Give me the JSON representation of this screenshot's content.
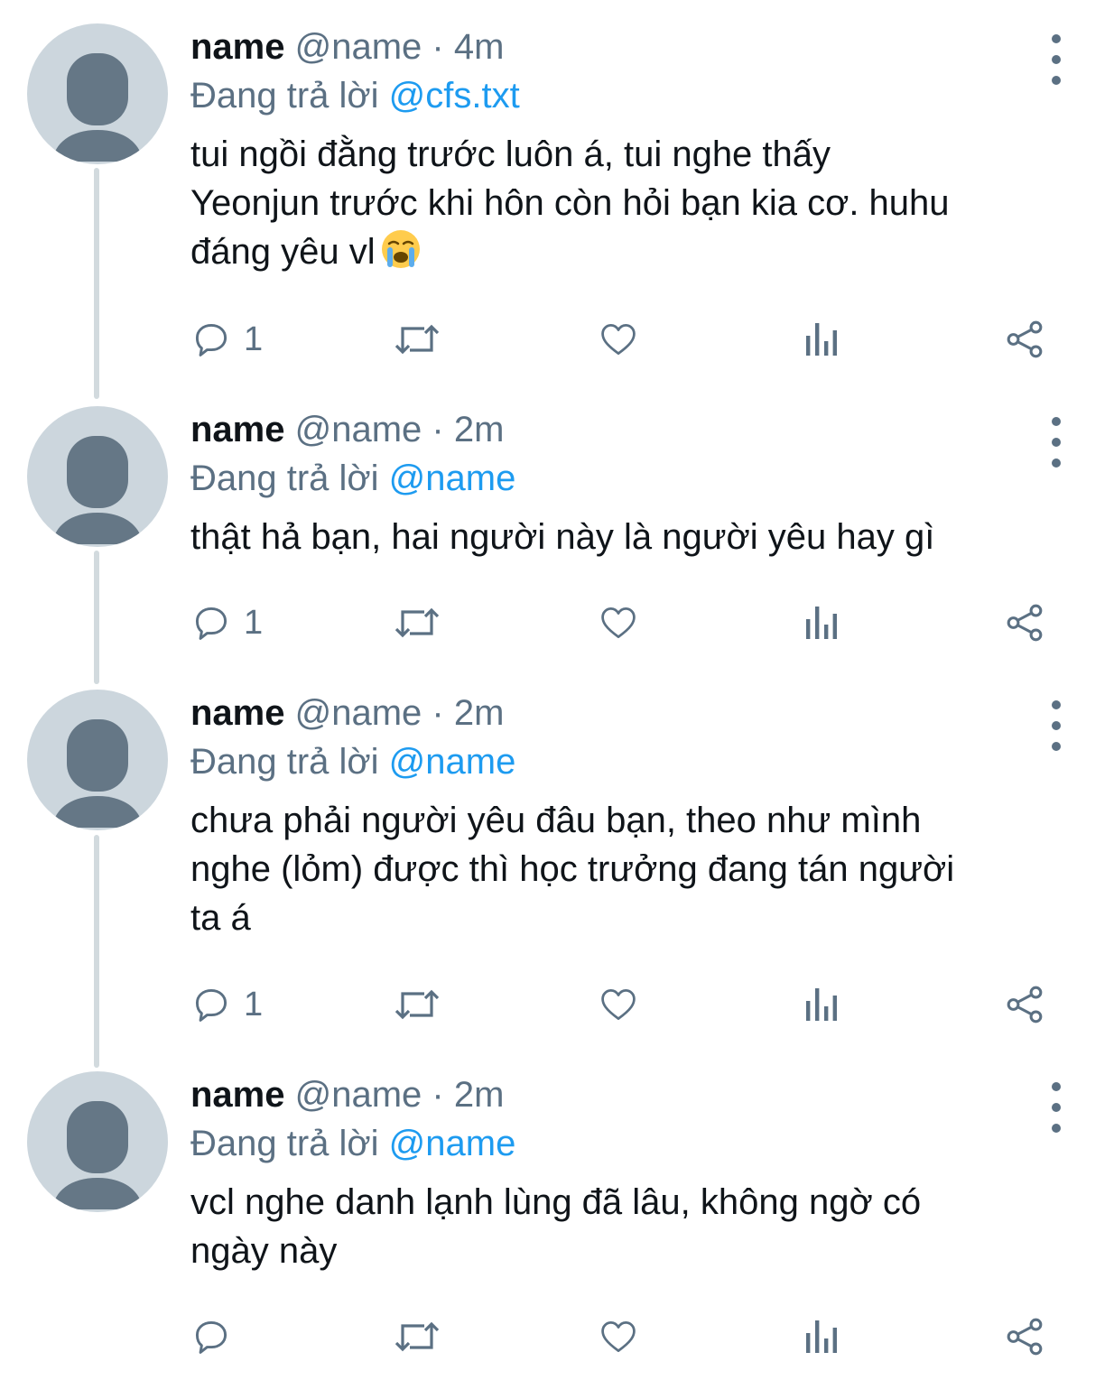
{
  "tweets": [
    {
      "name": "name",
      "handle": "@name",
      "separator": "·",
      "time": "4m",
      "reply_prefix": "Đang trả lời",
      "reply_to": "@cfs.txt",
      "text": "tui ngồi đằng trước luôn á, tui nghe thấy\nYeonjun trước khi hôn còn hỏi bạn kia cơ. huhu\nđáng yêu vl",
      "emoji": "loudly-crying-face",
      "reply_count": "1"
    },
    {
      "name": "name",
      "handle": "@name",
      "separator": "·",
      "time": "2m",
      "reply_prefix": "Đang trả lời",
      "reply_to": "@name",
      "text": "thật hả bạn, hai người này là người yêu hay gì",
      "reply_count": "1"
    },
    {
      "name": "name",
      "handle": "@name",
      "separator": "·",
      "time": "2m",
      "reply_prefix": "Đang trả lời",
      "reply_to": "@name",
      "text": "chưa phải người yêu đâu bạn, theo như mình\nnghe (lỏm) được thì học trưởng đang tán người\nta á",
      "reply_count": "1"
    },
    {
      "name": "name",
      "handle": "@name",
      "separator": "·",
      "time": "2m",
      "reply_prefix": "Đang trả lời",
      "reply_to": "@name",
      "text": "vcl nghe danh lạnh lùng đã lâu, không ngờ có\nngày này",
      "reply_count": ""
    }
  ],
  "icons": {
    "reply": "reply-icon",
    "retweet": "retweet-icon",
    "like": "heart-icon",
    "analytics": "analytics-icon",
    "share": "share-icon",
    "more": "more-vertical-icon"
  },
  "colors": {
    "text": "#0f1419",
    "secondary": "#5b7083",
    "mention": "#1d9bf0",
    "avatar_bg": "#ccd6dd",
    "avatar_fg": "#657786",
    "thread_line": "#d2dade"
  }
}
